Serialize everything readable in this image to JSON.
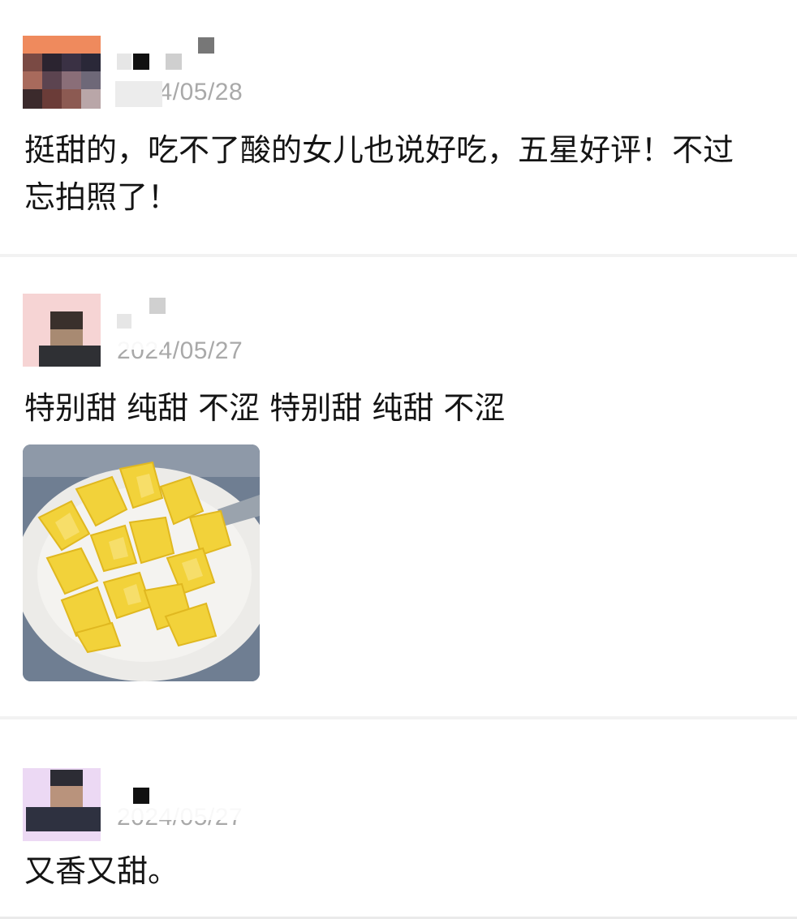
{
  "reviews": [
    {
      "date": "2024/05/28",
      "comment": "挺甜的，吃不了酸的女儿也说好吃，五星好评！不过忘拍照了！",
      "avatar_colors": [
        "#e8734a",
        "#5a3b3b",
        "#3a3040"
      ]
    },
    {
      "date": "2024/05/27",
      "comment": "特别甜 纯甜 不涩 特别甜 纯甜 不涩",
      "avatar_colors": [
        "#f5cfcf",
        "#3b342f",
        "#a88a6e"
      ],
      "photo_alt": "pineapple-chunks-on-plate"
    },
    {
      "date": "2024/05/27",
      "comment": "又香又甜。",
      "avatar_colors": [
        "#e8d3f2",
        "#2c2f3a",
        "#b8937a"
      ]
    }
  ],
  "colors": {
    "text": "#141414",
    "date": "#a9a9a9",
    "divider": "#f2f2f2"
  }
}
